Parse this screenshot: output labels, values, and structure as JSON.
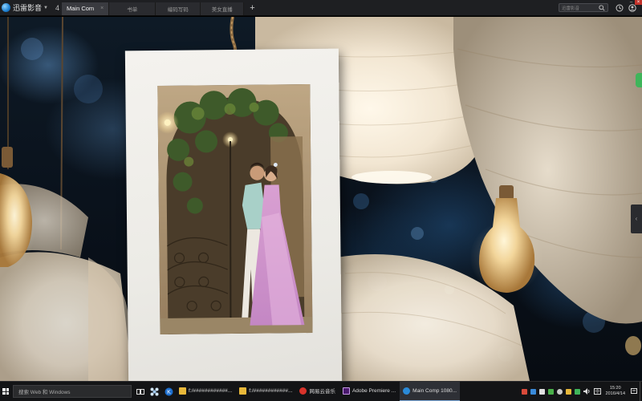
{
  "titlebar": {
    "app_name": "迅雷影音",
    "tab_counter": "4",
    "tabs": [
      {
        "label": "Main Com",
        "active": true
      },
      {
        "label": "书单",
        "active": false
      },
      {
        "label": "编码写码",
        "active": false
      },
      {
        "label": "美女直播",
        "active": false
      }
    ],
    "search_placeholder": "迅雷影音"
  },
  "taskbar": {
    "search_placeholder": "搜索 Web 和 Windows",
    "apps": [
      {
        "label": "f:/############...",
        "icon": "folder-icon",
        "color": "#e8b83a",
        "active": false
      },
      {
        "label": "f:/############...",
        "icon": "folder-icon",
        "color": "#e8b83a",
        "active": false
      },
      {
        "label": "网易云音乐",
        "icon": "netease-music-icon",
        "color": "#d9332b",
        "active": false
      },
      {
        "label": "Adobe Premiere ...",
        "icon": "premiere-icon",
        "color": "#4a1a6e",
        "active": false
      },
      {
        "label": "Main Comp 1080...",
        "icon": "thunder-player-icon",
        "color": "#2a8ad8",
        "active": true
      }
    ],
    "clock": {
      "time": "15:20",
      "date": "2016/4/14"
    },
    "tray_colors": [
      "#d94a3a",
      "#3a8ad9",
      "#e0e0e0",
      "#4ab04a",
      "#cccccc",
      "#e8b83a",
      "#3fb55a",
      "#cccccc",
      "#cccccc"
    ]
  }
}
